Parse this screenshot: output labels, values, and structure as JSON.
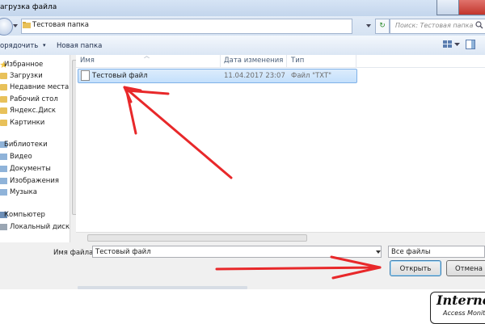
{
  "window": {
    "title": "агрузка файла"
  },
  "address": {
    "path": "Тестовая папка",
    "chevron": "▸",
    "refresh_symbol": "↻",
    "search_placeholder": "Поиск: Тестовая папка"
  },
  "toolbar": {
    "organize": "орядочить",
    "new_folder": "Новая папка",
    "dropdown_symbol": "▾"
  },
  "sidebar": {
    "sections": [
      {
        "label": "Избранное",
        "icon": "star-icon"
      },
      {
        "label": "Загрузки",
        "icon": "folder-icon"
      },
      {
        "label": "Недавние места",
        "icon": "folder-icon"
      },
      {
        "label": "Рабочий стол",
        "icon": "folder-icon"
      },
      {
        "label": "Яндекс.Диск",
        "icon": "folder-icon"
      },
      {
        "label": "Картинки",
        "icon": "folder-icon"
      },
      {
        "label": "Библиотеки",
        "icon": "library-icon"
      },
      {
        "label": "Видео",
        "icon": "library-icon"
      },
      {
        "label": "Документы",
        "icon": "library-icon"
      },
      {
        "label": "Изображения",
        "icon": "library-icon"
      },
      {
        "label": "Музыка",
        "icon": "library-icon"
      },
      {
        "label": "Компьютер",
        "icon": "computer-icon"
      },
      {
        "label": "Локальный диск",
        "icon": "disk-icon"
      }
    ]
  },
  "columns": {
    "name": "Имя",
    "modified": "Дата изменения",
    "type": "Тип"
  },
  "files": [
    {
      "name": "Тестовый файл",
      "modified": "11.04.2017 23:07",
      "type": "Файл \"TXT\""
    }
  ],
  "bottom": {
    "filename_label": "Имя файла:",
    "filename_value": "Тестовый файл",
    "filetype_value": "Все файлы",
    "open_label": "Открыть",
    "cancel_label": "Отмена"
  },
  "watermark": {
    "line1": "Interne",
    "line2": "Access Monit"
  },
  "colors": {
    "window_frame": "#cfdcec",
    "selection": "#c4e0fc",
    "arrow": "#e8282a"
  }
}
